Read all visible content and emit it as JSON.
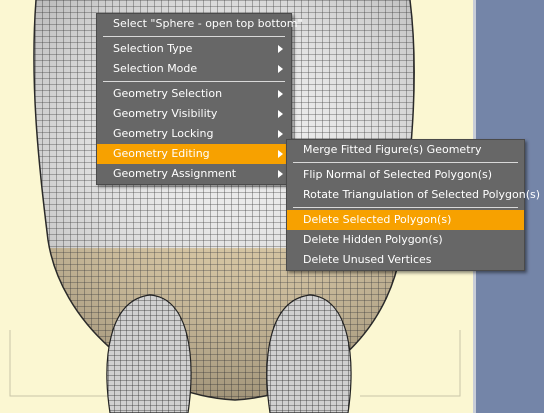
{
  "context_menu": {
    "title": "Select \"Sphere - open top bottom\"",
    "items": [
      {
        "label": "Selection Type",
        "arrow": true
      },
      {
        "label": "Selection Mode",
        "arrow": true
      },
      {
        "label": "Geometry Selection",
        "arrow": true
      },
      {
        "label": "Geometry Visibility",
        "arrow": true
      },
      {
        "label": "Geometry Locking",
        "arrow": true
      },
      {
        "label": "Geometry Editing",
        "arrow": true,
        "highlighted": true
      },
      {
        "label": "Geometry Assignment",
        "arrow": true
      }
    ]
  },
  "submenu": {
    "items": [
      {
        "label": "Merge Fitted Figure(s) Geometry"
      },
      {
        "label": "Flip Normal of Selected Polygon(s)"
      },
      {
        "label": "Rotate Triangulation of Selected Polygon(s)"
      },
      {
        "label": "Delete Selected Polygon(s)",
        "highlighted": true
      },
      {
        "label": "Delete Hidden Polygon(s)"
      },
      {
        "label": "Delete Unused Vertices"
      }
    ]
  },
  "colors": {
    "menu_bg": "#676767",
    "highlight": "#f7a100",
    "viewport_bg": "#fbf7d2",
    "side_panel": "#7485a8",
    "mesh_white": "#e8e8e8",
    "mesh_tan": "#d9c7a0"
  }
}
